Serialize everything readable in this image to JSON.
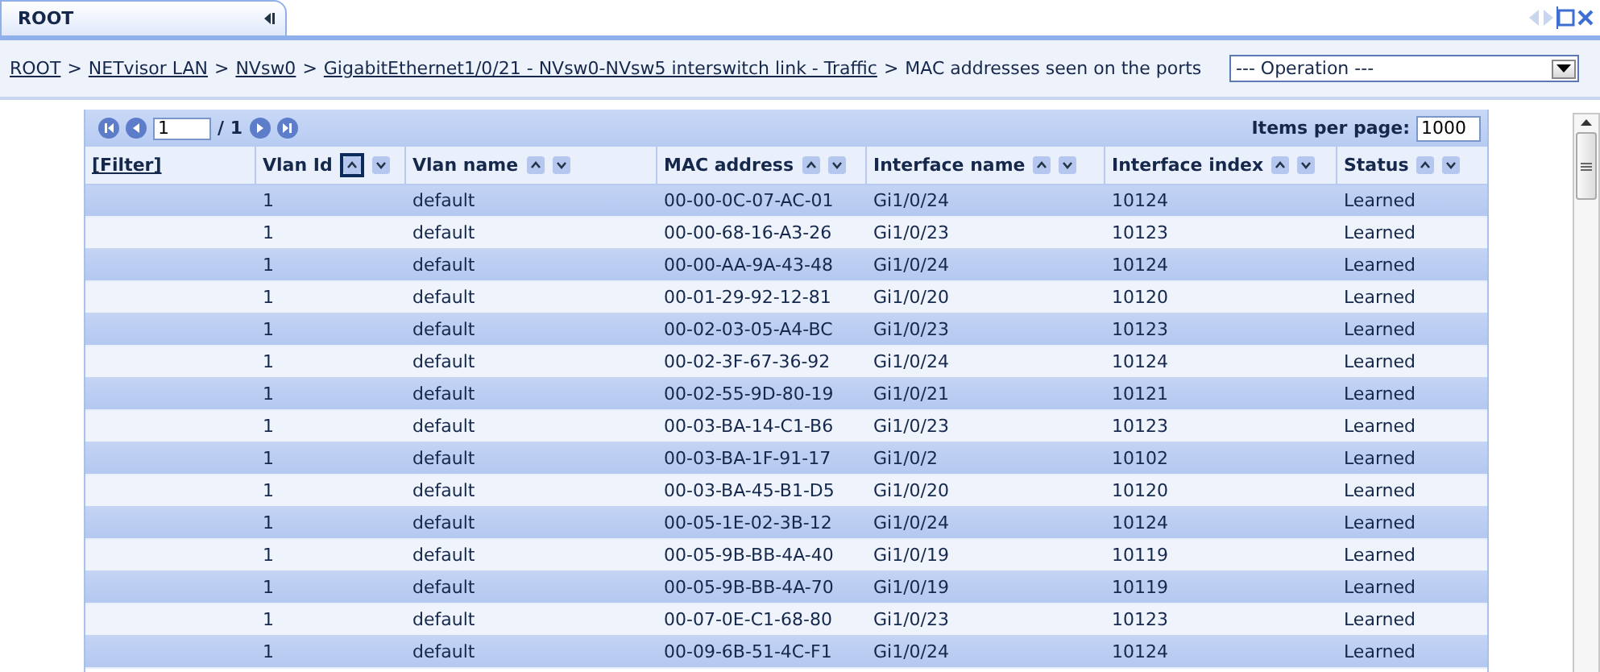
{
  "tab": {
    "label": "ROOT"
  },
  "breadcrumb": {
    "links": [
      "ROOT",
      "NETvisor LAN",
      "NVsw0",
      "GigabitEthernet1/0/21 - NVsw0-NVsw5 interswitch link - Traffic"
    ],
    "current": "MAC addresses seen on the ports",
    "separator": ">"
  },
  "operation_select": {
    "value": "--- Operation ---"
  },
  "pager": {
    "page": "1",
    "total": "/ 1",
    "items_per_page_label": "Items per page:",
    "items_per_page": "1000"
  },
  "table": {
    "columns": [
      {
        "label": "[Filter]",
        "kind": "filter"
      },
      {
        "label": "Vlan Id",
        "kind": "sortable",
        "sorted_ascending": true
      },
      {
        "label": "Vlan name",
        "kind": "sortable",
        "sorted_ascending": false
      },
      {
        "label": "MAC address",
        "kind": "sortable",
        "sorted_ascending": false
      },
      {
        "label": "Interface name",
        "kind": "sortable",
        "sorted_ascending": false
      },
      {
        "label": "Interface index",
        "kind": "sortable",
        "sorted_ascending": false
      },
      {
        "label": "Status",
        "kind": "sortable",
        "sorted_ascending": false
      }
    ],
    "rows": [
      [
        "",
        "1",
        "default",
        "00-00-0C-07-AC-01",
        "Gi1/0/24",
        "10124",
        "Learned"
      ],
      [
        "",
        "1",
        "default",
        "00-00-68-16-A3-26",
        "Gi1/0/23",
        "10123",
        "Learned"
      ],
      [
        "",
        "1",
        "default",
        "00-00-AA-9A-43-48",
        "Gi1/0/24",
        "10124",
        "Learned"
      ],
      [
        "",
        "1",
        "default",
        "00-01-29-92-12-81",
        "Gi1/0/20",
        "10120",
        "Learned"
      ],
      [
        "",
        "1",
        "default",
        "00-02-03-05-A4-BC",
        "Gi1/0/23",
        "10123",
        "Learned"
      ],
      [
        "",
        "1",
        "default",
        "00-02-3F-67-36-92",
        "Gi1/0/24",
        "10124",
        "Learned"
      ],
      [
        "",
        "1",
        "default",
        "00-02-55-9D-80-19",
        "Gi1/0/21",
        "10121",
        "Learned"
      ],
      [
        "",
        "1",
        "default",
        "00-03-BA-14-C1-B6",
        "Gi1/0/23",
        "10123",
        "Learned"
      ],
      [
        "",
        "1",
        "default",
        "00-03-BA-1F-91-17",
        "Gi1/0/2",
        "10102",
        "Learned"
      ],
      [
        "",
        "1",
        "default",
        "00-03-BA-45-B1-D5",
        "Gi1/0/20",
        "10120",
        "Learned"
      ],
      [
        "",
        "1",
        "default",
        "00-05-1E-02-3B-12",
        "Gi1/0/24",
        "10124",
        "Learned"
      ],
      [
        "",
        "1",
        "default",
        "00-05-9B-BB-4A-40",
        "Gi1/0/19",
        "10119",
        "Learned"
      ],
      [
        "",
        "1",
        "default",
        "00-05-9B-BB-4A-70",
        "Gi1/0/19",
        "10119",
        "Learned"
      ],
      [
        "",
        "1",
        "default",
        "00-07-0E-C1-68-80",
        "Gi1/0/23",
        "10123",
        "Learned"
      ],
      [
        "",
        "1",
        "default",
        "00-09-6B-51-4C-F1",
        "Gi1/0/24",
        "10124",
        "Learned"
      ]
    ]
  }
}
